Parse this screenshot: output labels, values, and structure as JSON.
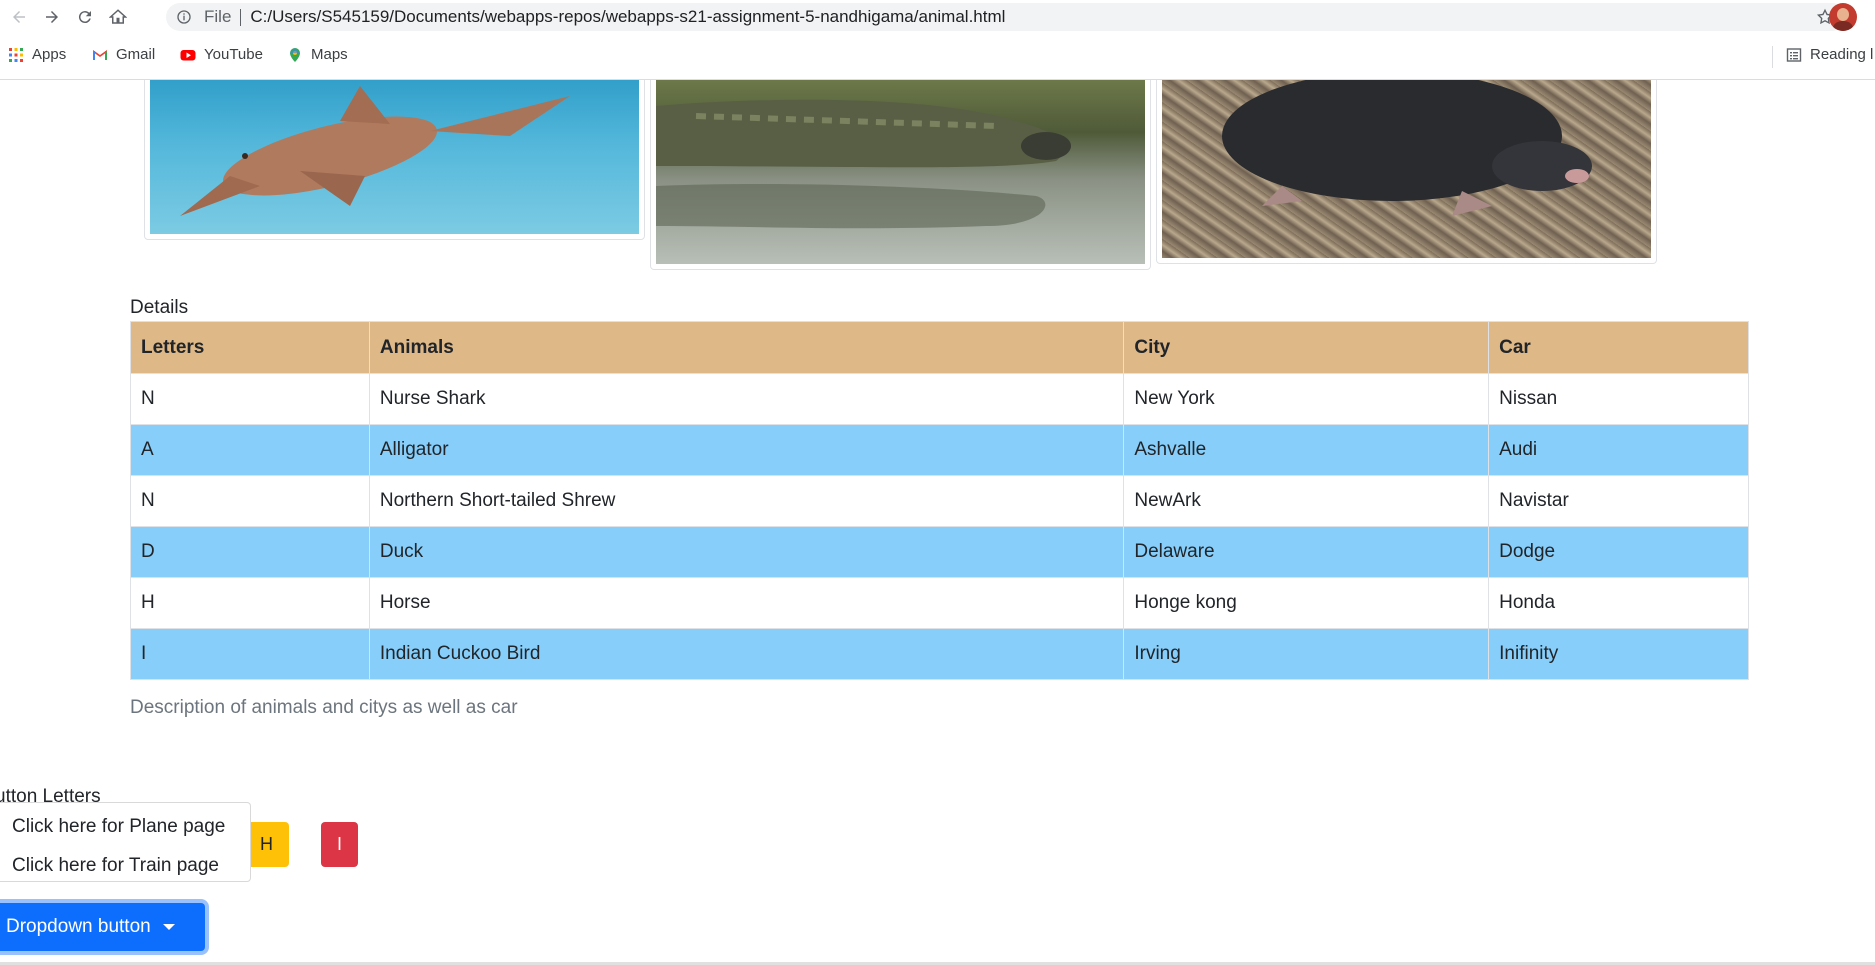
{
  "browser": {
    "scheme_label": "File",
    "url": "C:/Users/S545159/Documents/webapps-repos/webapps-s21-assignment-5-nandhigama/animal.html",
    "icons": [
      "back-icon",
      "forward-icon",
      "reload-icon",
      "home-icon",
      "info-icon",
      "star-icon",
      "profile-avatar"
    ]
  },
  "bookmarks": {
    "apps": "Apps",
    "gmail": "Gmail",
    "youtube": "YouTube",
    "maps": "Maps",
    "reading_list": "Reading l"
  },
  "content": {
    "details_label": "Details",
    "table": {
      "headers": [
        "Letters",
        "Animals",
        "City",
        "Car"
      ],
      "rows": [
        [
          "N",
          "Nurse Shark",
          "New York",
          "Nissan"
        ],
        [
          "A",
          "Alligator",
          "Ashvalle",
          "Audi"
        ],
        [
          "N",
          "Northern Short-tailed Shrew",
          "NewArk",
          "Navistar"
        ],
        [
          "D",
          "Duck",
          "Delaware",
          "Dodge"
        ],
        [
          "H",
          "Horse",
          "Honge kong",
          "Honda"
        ],
        [
          "I",
          "Indian Cuckoo Bird",
          "Irving",
          "Inifinity"
        ]
      ]
    },
    "table_caption": "Description of animals and citys as well as car",
    "button_heading": "utton Letters",
    "letter_buttons": [
      "H",
      "I"
    ],
    "dropdown": {
      "items": [
        "Click here for Plane page",
        "Click here for Train page"
      ],
      "button_label": "Dropdown button"
    }
  },
  "colors": {
    "header_bg": "#deb887",
    "alt_row_bg": "#87cefa",
    "primary": "#0d6efd",
    "warning": "#ffc107",
    "danger": "#dc3545"
  }
}
